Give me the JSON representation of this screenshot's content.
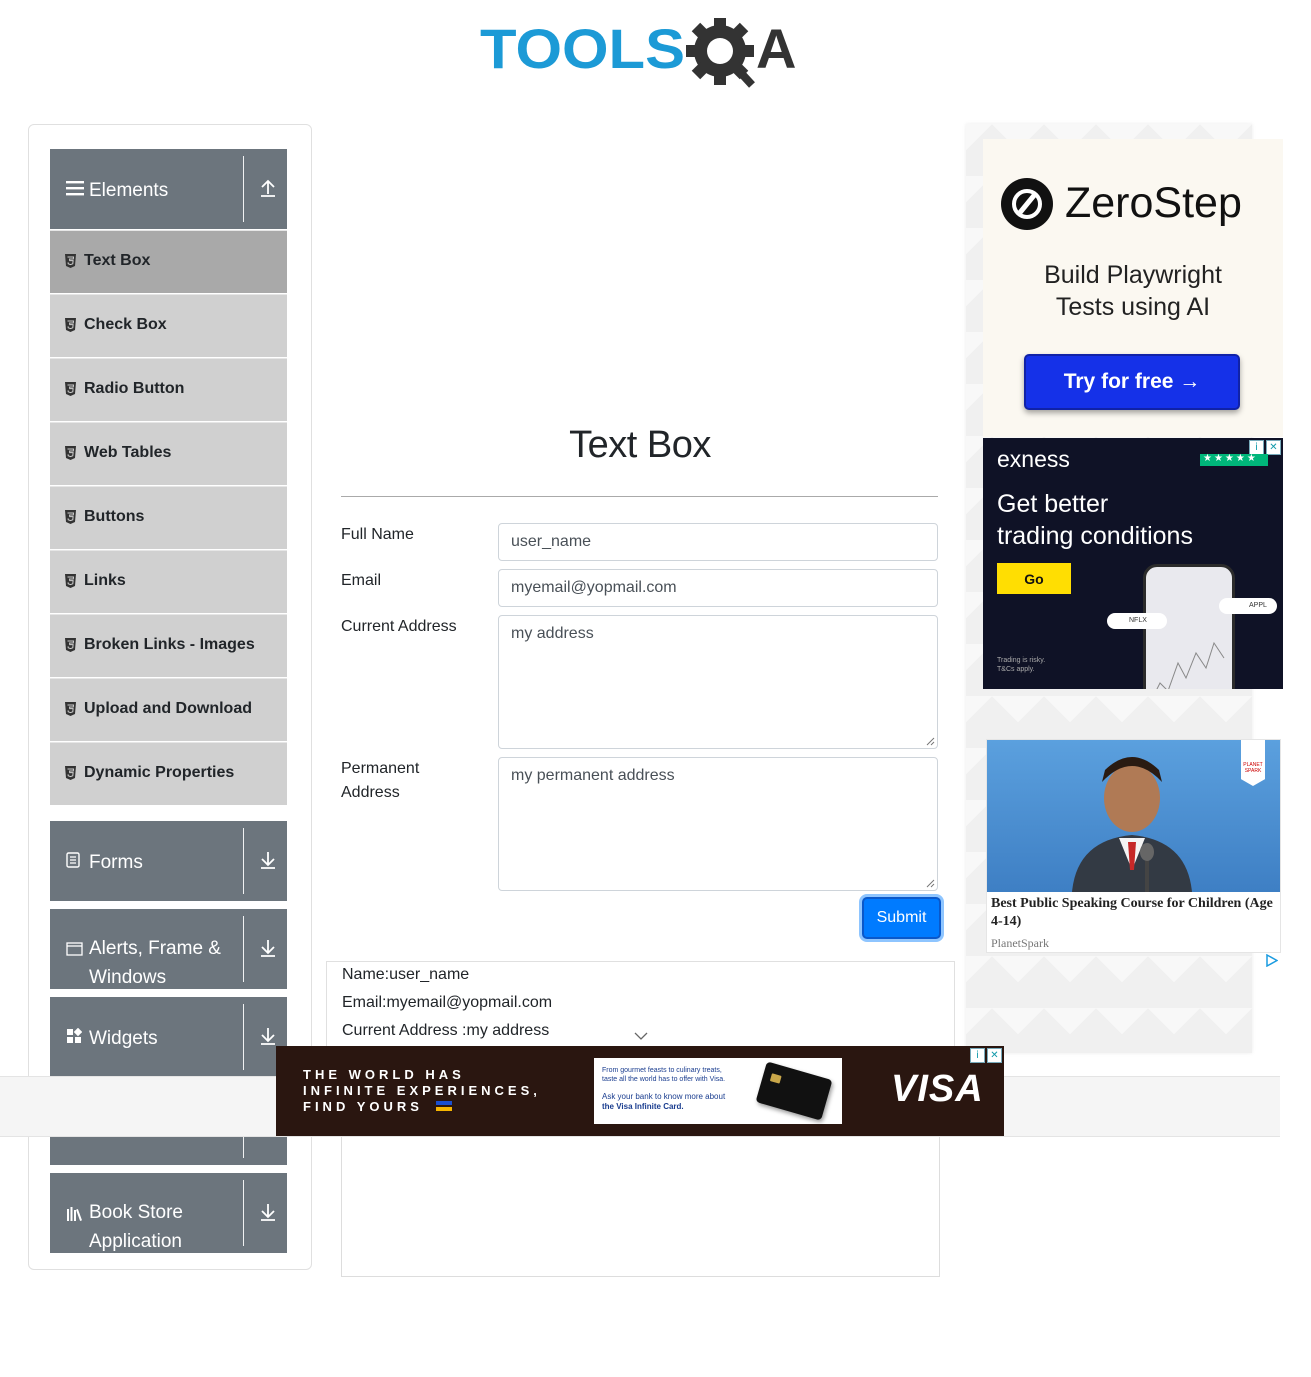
{
  "logo": {
    "text_left": "TOOLS",
    "text_right": "A"
  },
  "sidebar": {
    "groups": [
      {
        "label": "Elements"
      },
      {
        "label": "Forms"
      },
      {
        "label": "Alerts, Frame &",
        "label2": "Windows"
      },
      {
        "label": "Widgets"
      },
      {
        "label": "Book Store",
        "label2": "Application"
      }
    ],
    "items": [
      {
        "label": "Text Box"
      },
      {
        "label": "Check Box"
      },
      {
        "label": "Radio Button"
      },
      {
        "label": "Web Tables"
      },
      {
        "label": "Buttons"
      },
      {
        "label": "Links"
      },
      {
        "label": "Broken Links - Images"
      },
      {
        "label": "Upload and Download"
      },
      {
        "label": "Dynamic Properties"
      }
    ]
  },
  "main": {
    "title": "Text Box",
    "form": {
      "full_name_label": "Full Name",
      "full_name_value": "user_name",
      "email_label": "Email",
      "email_value": "myemail@yopmail.com",
      "current_address_label": "Current Address",
      "current_address_value": "my address",
      "permanent_address_label1": "Permanent",
      "permanent_address_label2": "Address",
      "permanent_address_value": "my permanent address",
      "submit_label": "Submit"
    },
    "output": {
      "name": "Name:user_name",
      "email": "Email:myemail@yopmail.com",
      "current_address": "Current Address :my address"
    }
  },
  "ads": {
    "zerostep": {
      "brand": "ZeroStep",
      "line1": "Build Playwright",
      "line2": "Tests using AI",
      "cta": "Try for free →"
    },
    "exness": {
      "brand": "exness",
      "line1": "Get better",
      "line2": "trading conditions",
      "cta": "Go",
      "disclaimer1": "Trading is risky.",
      "disclaimer2": "T&Cs apply.",
      "ticker1": "NFLX",
      "ticker2": "APPL"
    },
    "planetspark": {
      "title": "Best Public Speaking Course for Children (Age 4-14)",
      "source": "PlanetSpark",
      "logo1": "PLANET",
      "logo2": "SPARK"
    },
    "visa": {
      "line1": "THE WORLD HAS",
      "line2": "INFINITE EXPERIENCES,",
      "line3": "FIND YOURS",
      "card_text1": "From gourmet feasts to culinary treats,",
      "card_text2": "taste all the world has to offer with Visa.",
      "card_text3": "Ask your bank to know more about",
      "card_text4": "the Visa Infinite Card.",
      "brand": "VISA"
    }
  },
  "colors": {
    "accent": "#007bff",
    "sidebar_group": "#6c757d",
    "sidebar_item": "#d0d0d0",
    "sidebar_item_active": "#a9a9a9",
    "logo_blue": "#1c9ad6",
    "logo_dark": "#333333"
  }
}
